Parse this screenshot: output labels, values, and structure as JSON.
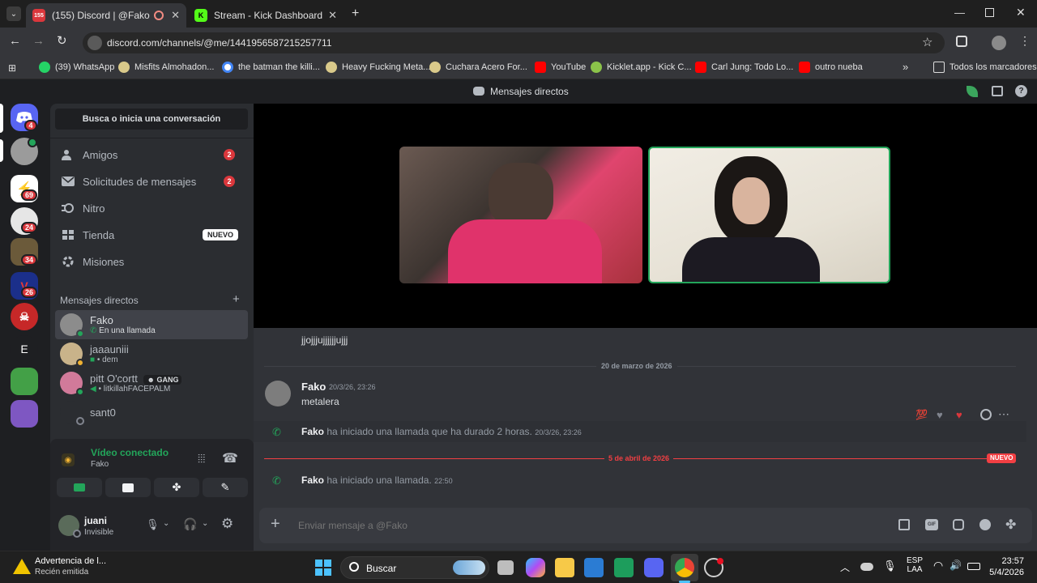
{
  "browser": {
    "tabs": [
      {
        "title": "(155) Discord | @Fako",
        "favicon_badge": "155"
      },
      {
        "title": "Stream - Kick Dashboard"
      }
    ],
    "url": "discord.com/channels/@me/1441956587215257711",
    "bookmarks": [
      "(39) WhatsApp",
      "Misfits Almohadon...",
      "the batman the killi...",
      "Heavy Fucking Meta...",
      "Cuchara Acero For...",
      "YouTube",
      "Kicklet.app - Kick C...",
      "Carl Jung: Todo Lo...",
      "outro nueba"
    ],
    "all_bookmarks": "Todos los marcadores"
  },
  "discord": {
    "window_title": "Mensajes directos",
    "servers": [
      {
        "badge": "4"
      },
      {
        "badge": ""
      },
      {
        "badge": "69"
      },
      {
        "badge": "24"
      },
      {
        "badge": "34"
      },
      {
        "badge": "26"
      },
      {
        "badge": ""
      },
      {
        "letter": "E"
      },
      {
        "badge": ""
      },
      {
        "badge": ""
      }
    ],
    "search_placeholder": "Busca o inicia una conversación",
    "nav": {
      "friends": {
        "label": "Amigos",
        "count": "2"
      },
      "requests": {
        "label": "Solicitudes de mensajes",
        "count": "2"
      },
      "nitro": {
        "label": "Nitro"
      },
      "shop": {
        "label": "Tienda",
        "tag": "NUEVO"
      },
      "quests": {
        "label": "Misiones"
      }
    },
    "dm_header": "Mensajes directos",
    "dms": [
      {
        "name": "Fako",
        "status": "En una llamada"
      },
      {
        "name": "jaaauniii",
        "status": "• dem"
      },
      {
        "name": "pitt O'cortt",
        "tag": "GANG",
        "status": "• litkillahFACEPALM"
      },
      {
        "name": "sant0",
        "status": ""
      }
    ],
    "voice": {
      "title": "Vídeo conectado",
      "sub": "Fako"
    },
    "user": {
      "name": "juani",
      "status": "Invisible"
    },
    "messages": {
      "prev_line": "jjojjjujjjjjjujjj",
      "date1": "20 de marzo de 2026",
      "author1": "Fako",
      "time1": "20/3/26, 23:26",
      "text1": "metalera",
      "call1_author": "Fako",
      "call1_text": "ha iniciado una llamada que ha durado 2 horas.",
      "call1_time": "20/3/26, 23:26",
      "date2": "5 de abril de 2026",
      "new_tag": "NUEVO",
      "call2_author": "Fako",
      "call2_text": "ha iniciado una llamada.",
      "call2_time": "22:50",
      "reaction": "💯"
    },
    "composer_placeholder": "Enviar mensaje a @Fako"
  },
  "taskbar": {
    "notif_title": "Advertencia de l...",
    "notif_sub": "Recién emitida",
    "search": "Buscar",
    "lang1": "ESP",
    "lang2": "LAA",
    "time": "23:57",
    "date": "5/4/2026"
  }
}
